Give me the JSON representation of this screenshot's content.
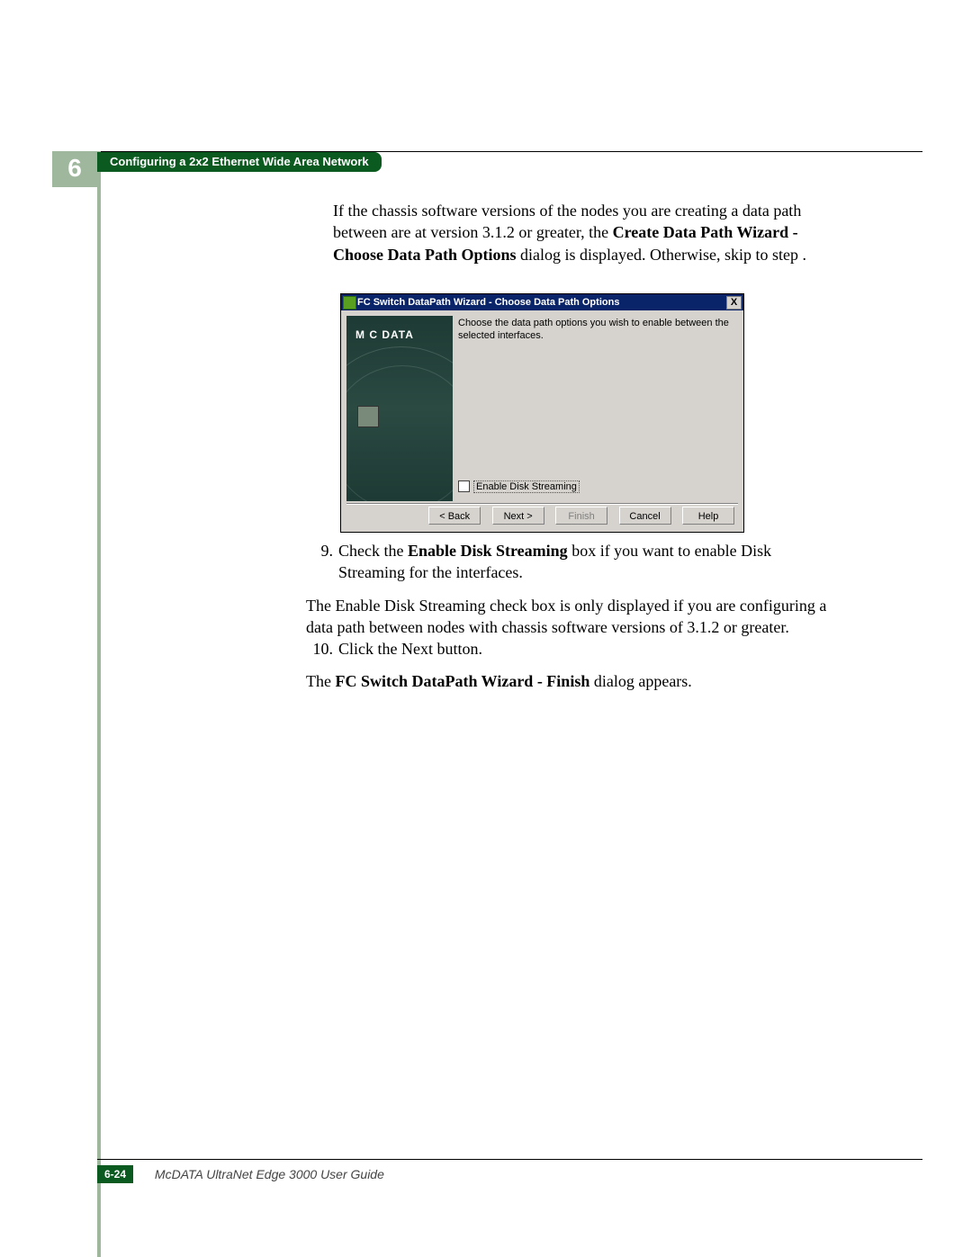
{
  "chapter_number": "6",
  "header_title": "Configuring a 2x2 Ethernet Wide Area Network",
  "intro": {
    "line1": "If the chassis software versions of the nodes you are creating a data path between are at version 3.1.2 or greater,  the ",
    "bold1": "Create Data Path Wizard - Choose Data Path Options",
    "line2": " dialog is displayed. Otherwise, skip to step ."
  },
  "dialog": {
    "title": "FC Switch DataPath Wizard - Choose Data Path Options",
    "close": "X",
    "logo": "M C DATA",
    "instruction": "Choose the data path options you wish to enable between the selected interfaces.",
    "checkbox_label": "Enable Disk Streaming",
    "buttons": {
      "back": "< Back",
      "next": "Next >",
      "finish": "Finish",
      "cancel": "Cancel",
      "help": "Help"
    }
  },
  "steps": {
    "s9_num": "9.",
    "s9a": "Check the ",
    "s9b": "Enable Disk Streaming",
    "s9c": " box if you want to enable Disk Streaming for the interfaces.",
    "s9_note": "The Enable Disk Streaming check box is only displayed if you are configuring a data path between nodes with chassis software versions of 3.1.2 or greater.",
    "s10_num": "10.",
    "s10": "Click the Next button.",
    "s10_note_a": "The ",
    "s10_note_b": "FC Switch DataPath Wizard - Finish",
    "s10_note_c": " dialog appears."
  },
  "footer": {
    "page": "6-24",
    "title": "McDATA UltraNet Edge 3000 User Guide"
  }
}
